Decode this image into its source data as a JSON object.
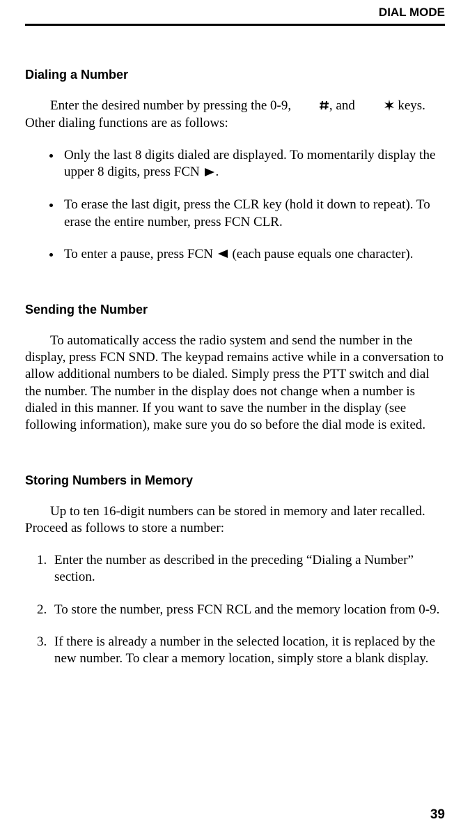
{
  "header": {
    "title": "DIAL MODE"
  },
  "page_number": "39",
  "section1": {
    "heading": "Dialing a Number",
    "intro_a": "Enter the desired number by pressing the 0-9, ",
    "intro_b": ", and ",
    "intro_c": " keys. Other dialing functions are as follows:",
    "bullets": {
      "b1a": "Only the last 8 digits dialed are displayed. To momentarily display the upper 8 digits, press FCN ",
      "b1b": ".",
      "b2": "To erase the last digit, press the CLR key (hold it down to repeat). To erase the entire number, press FCN CLR.",
      "b3a": "To enter a pause, press FCN ",
      "b3b": " (each pause equals one character)."
    }
  },
  "section2": {
    "heading": "Sending the Number",
    "para": "To automatically access the radio system and send the number in the display, press FCN SND. The keypad remains active while in a conversa­tion to allow additional numbers to be dialed. Simply press the PTT switch and dial the number. The number in the display does not change when a number is dialed in this manner. If you want to save the number in the display (see following information), make sure you do so before the dial mode is exited."
  },
  "section3": {
    "heading": "Storing Numbers in Memory",
    "intro": "Up to ten 16-digit numbers can be stored in memory and later recalled. Proceed as follows to store a number:",
    "items": {
      "i1": "Enter the number as described in the preceding “Dialing a Number” section.",
      "i2": "To store the number, press FCN RCL and the memory location from 0-9.",
      "i3": "If there is already a number in the selected location, it is replaced by the new number. To clear a memory location, simply store a blank display."
    }
  },
  "icons": {
    "hash": "hash-icon",
    "asterisk": "asterisk-icon",
    "right": "right-triangle-icon",
    "left": "left-triangle-icon"
  }
}
